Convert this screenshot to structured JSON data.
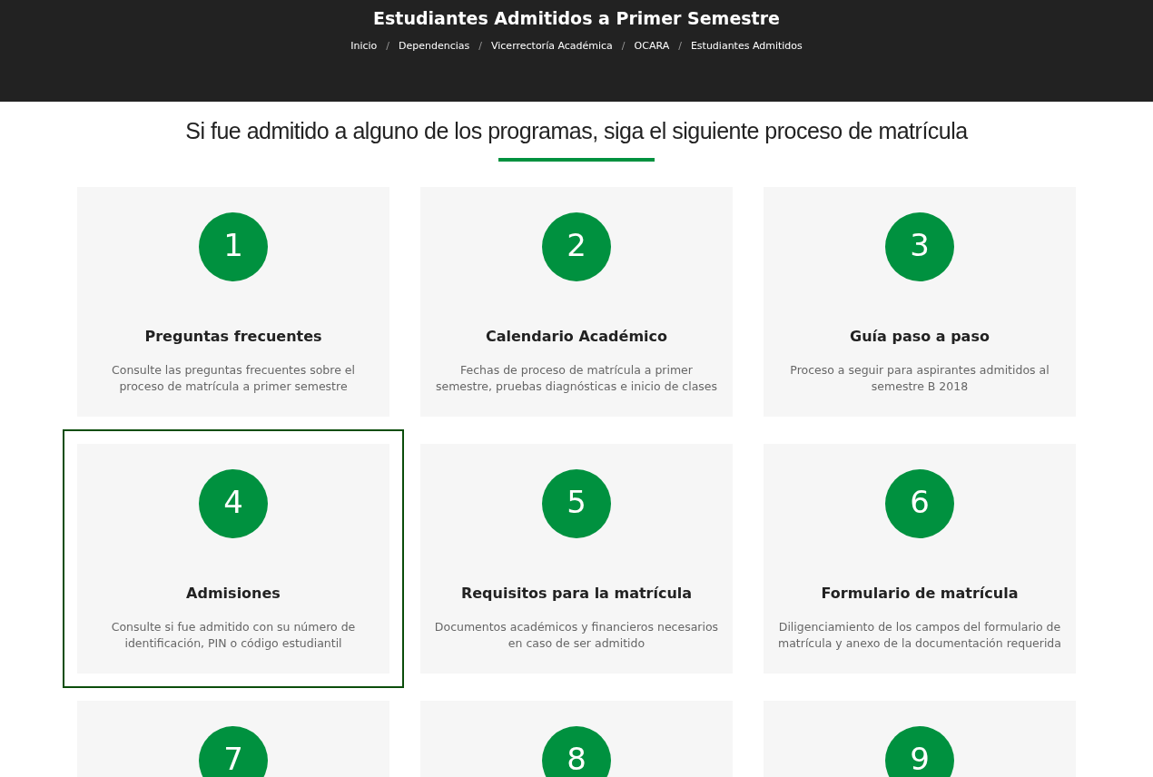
{
  "header": {
    "title": "Estudiantes Admitidos a Primer Semestre",
    "breadcrumb": {
      "separator": "/",
      "items": [
        "Inicio",
        "Dependencias",
        "Vicerrectoría Académica",
        "OCARA",
        "Estudiantes Admitidos"
      ]
    }
  },
  "heading": "Si fue admitido a alguno de los programas, siga el siguiente proceso de matrícula",
  "cards": [
    {
      "number": "1",
      "title": "Preguntas frecuentes",
      "description": "Consulte las preguntas frecuentes sobre el proceso de matrícula a primer semestre",
      "selected": false
    },
    {
      "number": "2",
      "title": "Calendario Académico",
      "description": "Fechas de proceso de matrícula a primer semestre, pruebas diagnósticas e inicio de clases",
      "selected": false
    },
    {
      "number": "3",
      "title": "Guía paso a paso",
      "description": "Proceso a seguir para aspirantes admitidos al semestre B 2018",
      "selected": false
    },
    {
      "number": "4",
      "title": "Admisiones",
      "description": "Consulte si fue admitido con su número de identificación, PIN o código estudiantil",
      "selected": true
    },
    {
      "number": "5",
      "title": "Requisitos para la matrícula",
      "description": "Documentos académicos y financieros necesarios en caso de ser admitido",
      "selected": false
    },
    {
      "number": "6",
      "title": "Formulario de matrícula",
      "description": "Diligenciamiento de los campos del formulario de matrícula y anexo de la documentación requerida",
      "selected": false
    },
    {
      "number": "7",
      "selected": false
    },
    {
      "number": "8",
      "selected": false
    },
    {
      "number": "9",
      "selected": false
    }
  ]
}
